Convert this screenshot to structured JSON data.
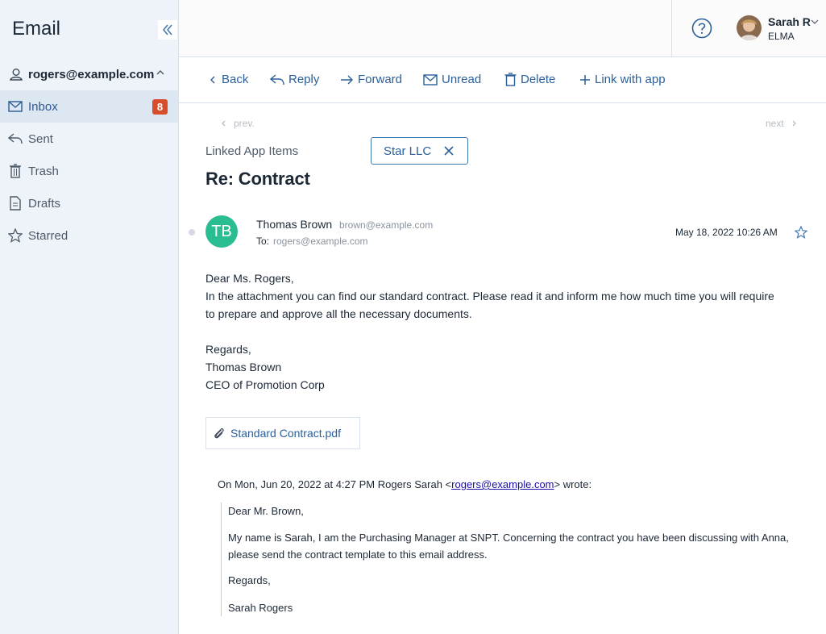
{
  "app": {
    "title": "Email"
  },
  "sidebar": {
    "account": "rogers@example.com",
    "items": [
      {
        "label": "Inbox",
        "badge": "8",
        "icon": "envelope-icon"
      },
      {
        "label": "Sent",
        "icon": "reply-arrow-icon"
      },
      {
        "label": "Trash",
        "icon": "trash-icon"
      },
      {
        "label": "Drafts",
        "icon": "document-icon"
      },
      {
        "label": "Starred",
        "icon": "star-icon"
      }
    ]
  },
  "user": {
    "name": "Sarah R",
    "org": "ELMA"
  },
  "toolbar": {
    "back": "Back",
    "reply": "Reply",
    "forward": "Forward",
    "unread": "Unread",
    "delete": "Delete",
    "link": "Link with app"
  },
  "pager": {
    "prev": "prev.",
    "next": "next"
  },
  "linked": {
    "label": "Linked App Items",
    "chip": "Star LLC"
  },
  "message": {
    "subject": "Re: Contract",
    "avatar_initials": "TB",
    "sender_name": "Thomas Brown",
    "sender_email": "brown@example.com",
    "to_label": "To:",
    "to_email": "rogers@example.com",
    "date": "May 18, 2022 10:26 AM",
    "body": {
      "greeting": "Dear Ms. Rogers,",
      "line1": "In the attachment you can find our standard contract. Please read it and inform me how much time you will require",
      "line2": "to prepare and approve all the necessary documents.",
      "regards": "Regards,",
      "sig_name": "Thomas Brown",
      "sig_title": "CEO of Promotion Corp"
    },
    "attachment": "Standard Contract.pdf",
    "quote": {
      "head_prefix": "On Mon, Jun 20, 2022 at 4:27 PM Rogers Sarah <",
      "head_link": "rogers@example.com",
      "head_suffix": "> wrote:",
      "greeting": "Dear Mr. Brown,",
      "line1": "My name is Sarah, I am the Purchasing Manager at SNPT. Concerning the contract you have been discussing with Anna,",
      "line2": "please send the contract template to this email address.",
      "regards": "Regards,",
      "sig": "Sarah Rogers"
    }
  },
  "colors": {
    "accent": "#2a5f9a",
    "badge": "#d84e2a",
    "avatar": "#2bbd92",
    "sidebar_bg": "#eef3f9",
    "sidebar_active": "#dde7f2"
  }
}
